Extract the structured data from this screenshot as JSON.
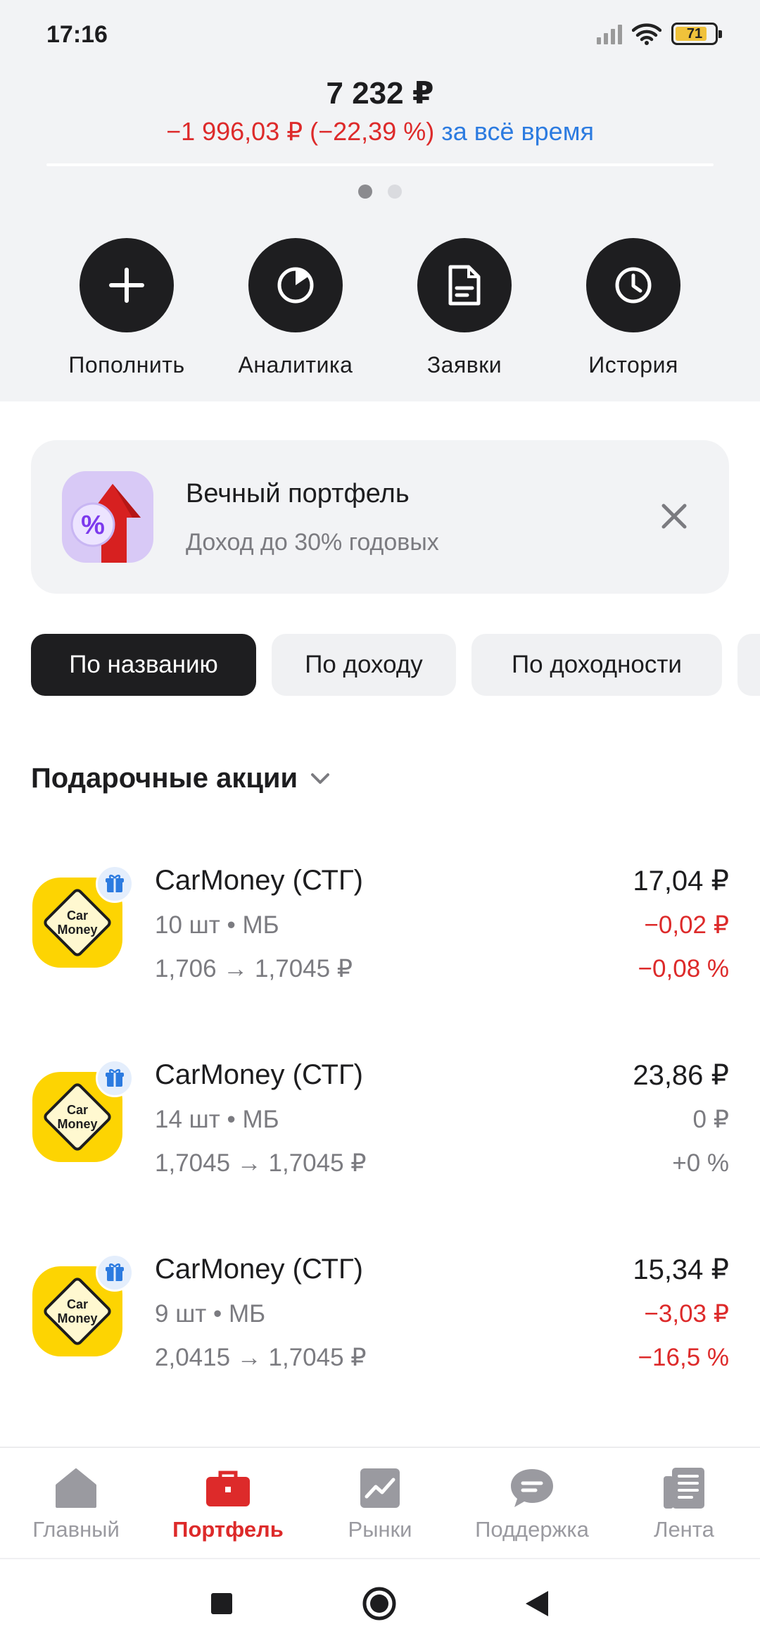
{
  "status_bar": {
    "time": "17:16",
    "battery": "71"
  },
  "summary": {
    "total": "7 232 ₽",
    "change": "−1 996,03 ₽ (−22,39 %)",
    "period": "за всё время"
  },
  "actions": [
    {
      "label": "Пополнить",
      "icon": "plus-icon"
    },
    {
      "label": "Аналитика",
      "icon": "pie-chart-icon"
    },
    {
      "label": "Заявки",
      "icon": "document-icon"
    },
    {
      "label": "История",
      "icon": "clock-icon"
    }
  ],
  "promo": {
    "title": "Вечный портфель",
    "subtitle": "Доход до 30% годовых",
    "badge_text": "%"
  },
  "sort_chips": [
    {
      "label": "По названию",
      "active": true
    },
    {
      "label": "По доходу",
      "active": false
    },
    {
      "label": "По доходности",
      "active": false
    }
  ],
  "section": {
    "title": "Подарочные акции"
  },
  "assets": [
    {
      "name": "CarMoney (СТГ)",
      "qty": "10 шт • МБ",
      "price": "1,706 → 1,7045 ₽",
      "value": "17,04 ₽",
      "delta": "−0,02 ₽",
      "pct": "−0,08 %",
      "logo_text": [
        "Car",
        "Money"
      ]
    },
    {
      "name": "CarMoney (СТГ)",
      "qty": "14 шт • МБ",
      "price": "1,7045 → 1,7045 ₽",
      "value": "23,86 ₽",
      "delta": "0 ₽",
      "pct": "+0 %",
      "logo_text": [
        "Car",
        "Money"
      ]
    },
    {
      "name": "CarMoney (СТГ)",
      "qty": "9 шт • МБ",
      "price": "2,0415 → 1,7045 ₽",
      "value": "15,34 ₽",
      "delta": "−3,03 ₽",
      "pct": "−16,5 %",
      "logo_text": [
        "Car",
        "Money"
      ]
    }
  ],
  "bottom_nav": [
    {
      "label": "Главный",
      "icon": "home-icon",
      "active": false
    },
    {
      "label": "Портфель",
      "icon": "briefcase-icon",
      "active": true
    },
    {
      "label": "Рынки",
      "icon": "chart-icon",
      "active": false
    },
    {
      "label": "Поддержка",
      "icon": "chat-icon",
      "active": false
    },
    {
      "label": "Лента",
      "icon": "news-icon",
      "active": false
    }
  ],
  "colors": {
    "accent_red": "#dd2a2a",
    "link_blue": "#2c7be0",
    "dark_button": "#1e1e20",
    "logo_yellow": "#fdd402"
  }
}
